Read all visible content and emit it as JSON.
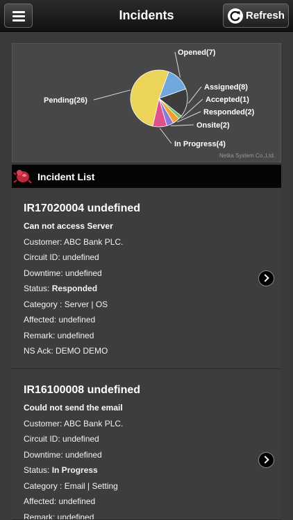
{
  "header": {
    "title": "Incidents",
    "refresh_label": "Refresh"
  },
  "chart_data": {
    "type": "pie",
    "categories": [
      "Opened",
      "Assigned",
      "Accepted",
      "Responded",
      "Onsite",
      "In Progress",
      "Pending"
    ],
    "values": [
      7,
      8,
      1,
      2,
      2,
      4,
      26
    ],
    "labels": [
      "Opened(7)",
      "Assigned(8)",
      "Accepted(1)",
      "Responded(2)",
      "Onsite(2)",
      "In Progress(4)",
      "Pending(26)"
    ],
    "colors": [
      "#6fa8dc",
      "#3d3d3d",
      "#6cc06c",
      "#f0a030",
      "#8a7ad8",
      "#e0508a",
      "#ecd35a"
    ],
    "credit": "Netka System Co.,Ltd."
  },
  "list": {
    "title": "Incident List"
  },
  "incidents": [
    {
      "id_line": "IR17020004 undefined",
      "subject": "Can not access Server",
      "customer": "Customer: ABC Bank PLC.",
      "circuit": "Circuit ID: undefined",
      "downtime": "Downtime: undefined",
      "status_prefix": "Status: ",
      "status": "Responded",
      "category": "Category : Server | OS",
      "affected": "Affected: undefined",
      "remark": "Remark: undefined",
      "ns_ack": "NS Ack: DEMO DEMO"
    },
    {
      "id_line": "IR16100008 undefined",
      "subject": "Could not send the email",
      "customer": "Customer: ABC Bank PLC.",
      "circuit": "Circuit ID: undefined",
      "downtime": "Downtime: undefined",
      "status_prefix": "Status: ",
      "status": "In Progress",
      "category": "Category : Email | Setting",
      "affected": "Affected: undefined",
      "remark": "Remark: undefined"
    }
  ]
}
